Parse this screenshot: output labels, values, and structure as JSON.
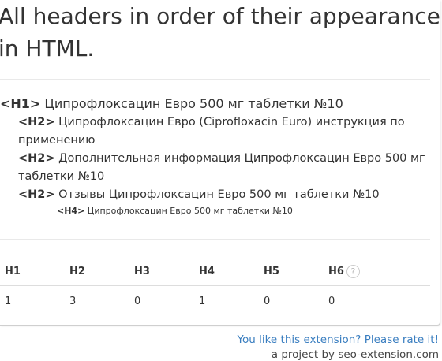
{
  "title": "All headers in order of their appearance in HTML.",
  "headers": {
    "h1": {
      "tag": "<H1>",
      "text": " Ципрофлоксацин Евро 500 мг таблетки №10"
    },
    "h2_1": {
      "tag": "<H2>",
      "text": " Ципрофлоксацин Евро (Ciprofloxacin Euro) инструкция по применению"
    },
    "h2_2": {
      "tag": "<H2>",
      "text": " Дополнительная информация Ципрофлоксацин Евро 500 мг таблетки №10"
    },
    "h2_3": {
      "tag": "<H2>",
      "text": " Отзывы Ципрофлоксацин Евро 500 мг таблетки №10"
    },
    "h4_1": {
      "tag": "<H4>",
      "text": " Ципрофлоксацин Евро 500 мг таблетки №10"
    }
  },
  "stats": {
    "columns": [
      "H1",
      "H2",
      "H3",
      "H4",
      "H5",
      "H6"
    ],
    "values": [
      "1",
      "3",
      "0",
      "1",
      "0",
      "0"
    ],
    "help_icon": "?"
  },
  "footer": {
    "rate_link": "You like this extension? Please rate it!",
    "project_text": "a project by seo-extension.com"
  }
}
